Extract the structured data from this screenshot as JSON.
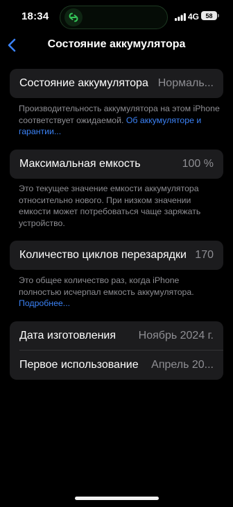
{
  "status_bar": {
    "time": "18:34",
    "network": "4G",
    "battery": "58",
    "island_icon": "recording-link-icon"
  },
  "nav": {
    "back_icon": "chevron-left-icon",
    "title": "Состояние аккумулятора"
  },
  "health": {
    "label": "Состояние аккумулятора",
    "value": "Нормаль...",
    "footer_text": "Производительность аккумулятора на этом iPhone соответствует ожидаемой.",
    "footer_link": "Об аккумуляторе и гарантии..."
  },
  "capacity": {
    "label": "Максимальная емкость",
    "value": "100 %",
    "footer_text": "Это текущее значение емкости аккумулятора относительно нового. При низком значении емкости может потребоваться чаще заряжать устройство."
  },
  "cycles": {
    "label": "Количество циклов перезарядки",
    "value": "170",
    "footer_text": "Это общее количество раз, когда iPhone полностью исчерпал емкость аккумулятора.",
    "footer_link": "Подробнее..."
  },
  "dates": {
    "manufacture_label": "Дата изготовления",
    "manufacture_value": "Ноябрь 2024 г.",
    "first_use_label": "Первое использование",
    "first_use_value": "Апрель 20..."
  },
  "colors": {
    "background": "#000000",
    "card": "#1c1c1e",
    "secondary_text": "#8e8e93",
    "accent": "#3b82f6",
    "island_glow": "#34c759"
  }
}
